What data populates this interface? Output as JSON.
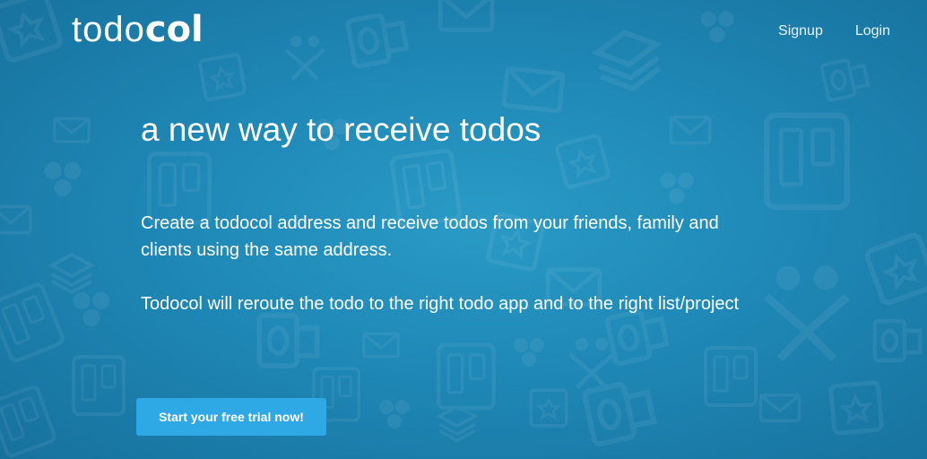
{
  "brand": {
    "logo_light": "todo",
    "logo_bold": "col"
  },
  "nav": {
    "signup": "Signup",
    "login": "Login"
  },
  "hero": {
    "headline": "a new way to receive todos",
    "paragraph1": "Create a todocol address and receive todos from your friends, family and clients using the same address.",
    "paragraph2": "Todocol will reroute the todo to the right todo app and to the right list/project",
    "cta_label": "Start your free trial now!"
  },
  "colors": {
    "background": "#1f88b6",
    "cta": "#2fa8e6",
    "text": "#ffffff"
  },
  "background_icons": [
    "mail-icon",
    "list-icon",
    "board-icon",
    "star-card-icon",
    "outlook-icon",
    "people-icon",
    "dots-icon"
  ]
}
